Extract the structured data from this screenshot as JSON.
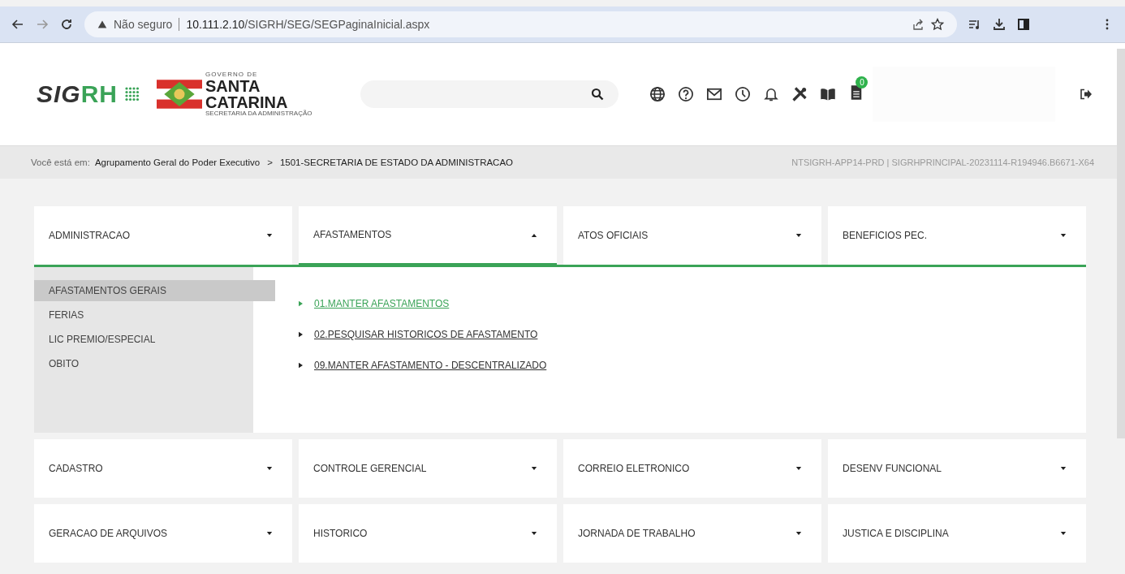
{
  "browser": {
    "security": "Não seguro",
    "url_host": "10.111.2.10",
    "url_path": "/SIGRH/SEG/SEGPaginaInicial.aspx"
  },
  "header": {
    "logo_main": "SIG",
    "logo_accent": "RH",
    "gov_small": "GOVERNO DE",
    "gov_line1": "SANTA",
    "gov_line2": "CATARINA",
    "gov_sub": "SECRETARIA DA ADMINISTRAÇÃO",
    "badge": "0"
  },
  "breadcrumb": {
    "prefix": "Você está em:",
    "items": [
      "Agrupamento Geral do Poder Executivo",
      "1501-SECRETARIA DE ESTADO DA ADMINISTRACAO"
    ],
    "separator": ">",
    "server": "NTSIGRH-APP14-PRD | SIGRHPRINCIPAL-20231114-R194946.B6671-X64"
  },
  "menu_rows": [
    [
      {
        "label": "ADMINISTRACAO",
        "expanded": false
      },
      {
        "label": "AFASTAMENTOS",
        "expanded": true
      },
      {
        "label": "ATOS OFICIAIS",
        "expanded": false
      },
      {
        "label": "BENEFICIOS PEC.",
        "expanded": false
      }
    ],
    [
      {
        "label": "CADASTRO",
        "expanded": false
      },
      {
        "label": "CONTROLE GERENCIAL",
        "expanded": false
      },
      {
        "label": "CORREIO ELETRONICO",
        "expanded": false
      },
      {
        "label": "DESENV FUNCIONAL",
        "expanded": false
      }
    ],
    [
      {
        "label": "GERACAO DE ARQUIVOS",
        "expanded": false
      },
      {
        "label": "HISTORICO",
        "expanded": false
      },
      {
        "label": "JORNADA DE TRABALHO",
        "expanded": false
      },
      {
        "label": "JUSTICA E DISCIPLINA",
        "expanded": false
      }
    ]
  ],
  "submenu": {
    "categories": [
      {
        "label": "AFASTAMENTOS GERAIS",
        "selected": true
      },
      {
        "label": "FERIAS",
        "selected": false
      },
      {
        "label": "LIC PREMIO/ESPECIAL",
        "selected": false
      },
      {
        "label": "OBITO",
        "selected": false
      }
    ],
    "links": [
      {
        "label": "01.MANTER AFASTAMENTOS",
        "hovered": true
      },
      {
        "label": "02.PESQUISAR HISTORICOS DE AFASTAMENTO",
        "hovered": false
      },
      {
        "label": "09.MANTER AFASTAMENTO - DESCENTRALIZADO",
        "hovered": false
      }
    ]
  }
}
